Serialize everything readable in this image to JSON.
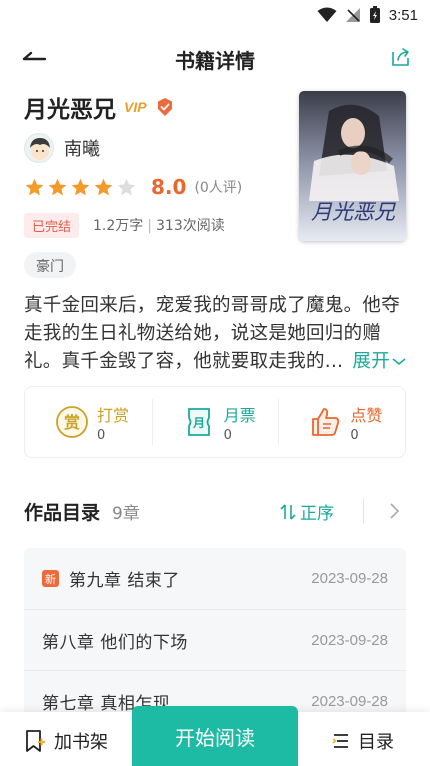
{
  "status_bar": {
    "time": "3:51"
  },
  "header": {
    "title": "书籍详情"
  },
  "book": {
    "title": "月光恶兄",
    "vip_label": "VIP",
    "author": "南曦",
    "score": "8.0",
    "score_count": "(0人评)",
    "rating_stars": 4,
    "status_tag": "已完结",
    "word_count": "1.2万字",
    "separator": "|",
    "read_count": "313次阅读",
    "genre": "豪门",
    "cover_title_text": "月光恶兄",
    "synopsis": "真千金回来后，宠爱我的哥哥成了魔鬼。他夺走我的生日礼物送给她，说这是她回归的赠礼。真千金毁了容，他就要取走我的...",
    "expand_label": "展开"
  },
  "actions": [
    {
      "label": "打赏",
      "count": "0",
      "color": "#c9a227",
      "icon": "reward-icon"
    },
    {
      "label": "月票",
      "count": "0",
      "color": "#1aaa9a",
      "icon": "monthly-ticket-icon"
    },
    {
      "label": "点赞",
      "count": "0",
      "color": "#e9672c",
      "icon": "like-icon"
    }
  ],
  "toc": {
    "title": "作品目录",
    "count": "9章",
    "sort_label": "正序",
    "new_badge": "新",
    "chapters": [
      {
        "title": "第九章  结束了",
        "date": "2023-09-28",
        "is_new": true
      },
      {
        "title": "第八章  他们的下场",
        "date": "2023-09-28",
        "is_new": false
      },
      {
        "title": "第七章  真相乍现",
        "date": "2023-09-28",
        "is_new": false
      }
    ]
  },
  "bottom_bar": {
    "add_shelf_label": "加书架",
    "read_label": "开始阅读",
    "toc_label": "目录"
  },
  "colors": {
    "accent": "#1dbba4",
    "score": "#e9672c",
    "star_on": "#f39a2b",
    "star_off": "#dddddd"
  }
}
